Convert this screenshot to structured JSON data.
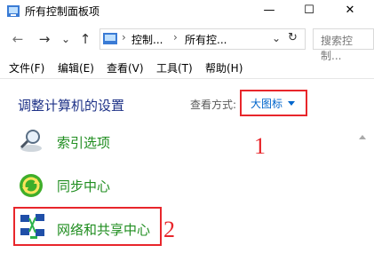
{
  "window": {
    "title": "所有控制面板项",
    "controls": {
      "minimize": "—",
      "maximize": "☐",
      "close": "✕"
    }
  },
  "nav": {
    "back": "←",
    "forward": "→",
    "history": "⌄",
    "up": "↑",
    "breadcrumb": [
      "控制...",
      "所有控..."
    ],
    "separator": "›",
    "dropdown": "⌄",
    "refresh": "↻",
    "search_placeholder": "搜索控制..."
  },
  "menu": [
    {
      "label": "文件(F)"
    },
    {
      "label": "编辑(E)"
    },
    {
      "label": "查看(V)"
    },
    {
      "label": "工具(T)"
    },
    {
      "label": "帮助(H)"
    }
  ],
  "content": {
    "heading": "调整计算机的设置",
    "view_by_label": "查看方式:",
    "view_by_value": "大图标",
    "items": [
      {
        "label": "索引选项",
        "icon": "magnifier-icon"
      },
      {
        "label": "同步中心",
        "icon": "sync-icon"
      },
      {
        "label": "网络和共享中心",
        "icon": "network-icon"
      }
    ]
  },
  "annotations": {
    "step1": "1",
    "step2": "2"
  },
  "colors": {
    "highlight": "#e8262b",
    "link": "#0066cc",
    "item_text": "#1f8d1f",
    "heading": "#1e3287"
  }
}
